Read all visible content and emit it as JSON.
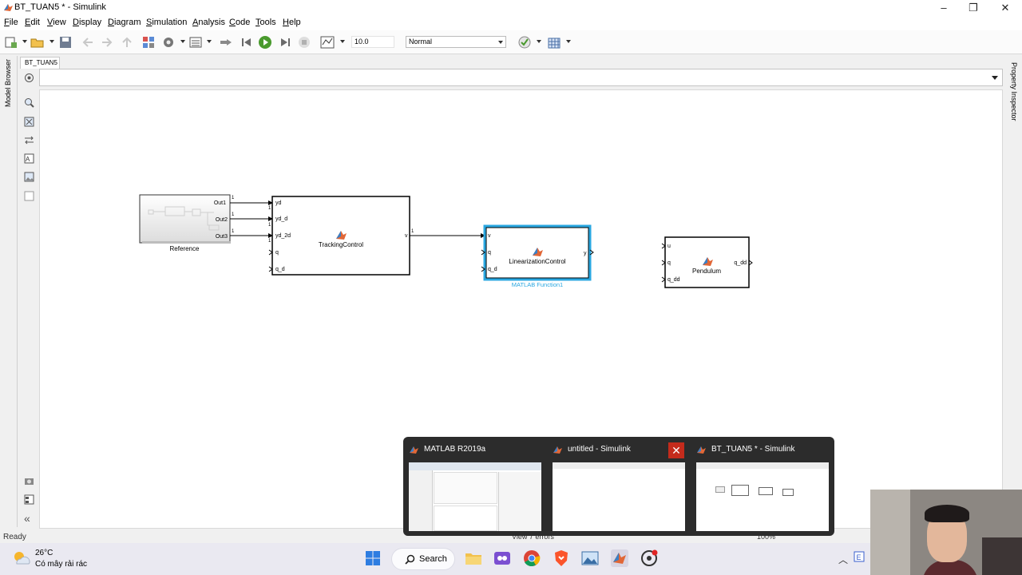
{
  "window": {
    "title": "BT_TUAN5 * - Simulink"
  },
  "menu": [
    {
      "label": "File",
      "u": "F",
      "rest": "ile"
    },
    {
      "label": "Edit",
      "u": "E",
      "rest": "dit"
    },
    {
      "label": "View",
      "u": "V",
      "rest": "iew"
    },
    {
      "label": "Display",
      "u": "D",
      "rest": "isplay"
    },
    {
      "label": "Diagram",
      "u": "D",
      "rest": "iagram"
    },
    {
      "label": "Simulation",
      "u": "S",
      "rest": "imulation"
    },
    {
      "label": "Analysis",
      "u": "A",
      "rest": "nalysis"
    },
    {
      "label": "Code",
      "u": "C",
      "rest": "ode"
    },
    {
      "label": "Tools",
      "u": "T",
      "rest": "ools"
    },
    {
      "label": "Help",
      "u": "H",
      "rest": "elp"
    }
  ],
  "toolbar": {
    "stop_time": "10.0",
    "sim_mode": "Normal"
  },
  "side_panels": {
    "left": "Model Browser",
    "right": "Property Inspector"
  },
  "model_tab": "BT_TUAN5",
  "blocks": {
    "reference": {
      "name": "Reference",
      "ports_out": [
        "Out1",
        "Out2",
        "Out3"
      ]
    },
    "tracking": {
      "name": "TrackingControl",
      "ports_in": [
        "yd",
        "yd_d",
        "yd_2d",
        "q",
        "q_d"
      ],
      "ports_out": [
        "v"
      ]
    },
    "linearization": {
      "name": "LinearizationControl",
      "caption": "MATLAB Function1",
      "ports_in": [
        "v",
        "q",
        "q_d"
      ],
      "ports_out": [
        "y"
      ]
    },
    "pendulum": {
      "name": "Pendulum",
      "ports_in": [
        "u",
        "q",
        "q_dd"
      ],
      "ports_out": [
        "q_dd"
      ]
    }
  },
  "signal_labels": [
    "1",
    "1",
    "1",
    "1",
    "1",
    "1",
    "1"
  ],
  "status": {
    "left": "Ready",
    "center": "View 7 errors",
    "right": "100%"
  },
  "taskbar": {
    "weather_temp": "26°C",
    "weather_desc": "Có mây rải rác",
    "search_label": "Search",
    "preview_windows": [
      {
        "title": "MATLAB R2019a"
      },
      {
        "title": "untitled - Simulink"
      },
      {
        "title": "BT_TUAN5 * - Simulink"
      }
    ]
  },
  "colors": {
    "accent_selected": "#2aa7e0",
    "matlab_orange": "#e16737",
    "close_red": "#c42b1c"
  }
}
